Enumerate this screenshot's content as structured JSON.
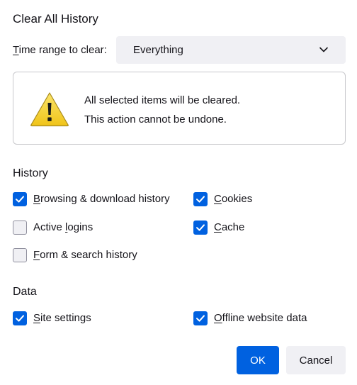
{
  "dialog": {
    "title": "Clear All History"
  },
  "time_range": {
    "label_first": "T",
    "label_rest": "ime range to clear:",
    "selected": "Everything",
    "chevron_icon": "chevron-down-icon"
  },
  "warning": {
    "icon": "warning-triangle-icon",
    "line1": "All selected items will be cleared.",
    "line2": "This action cannot be undone."
  },
  "history": {
    "heading": "History",
    "items": [
      {
        "u": "B",
        "rest": "rowsing & download history",
        "checked": true
      },
      {
        "u": "C",
        "rest": "ookies",
        "checked": true
      },
      {
        "pre": "Active ",
        "u": "l",
        "rest": "ogins",
        "checked": false
      },
      {
        "u": "C",
        "rest": "ache",
        "checked": true
      },
      {
        "u": "F",
        "rest": "orm & search history",
        "checked": false
      }
    ]
  },
  "data": {
    "heading": "Data",
    "items": [
      {
        "u": "S",
        "rest": "ite settings",
        "checked": true
      },
      {
        "u": "O",
        "rest": "ffline website data",
        "checked": true
      }
    ]
  },
  "buttons": {
    "ok": "OK",
    "cancel": "Cancel"
  },
  "colors": {
    "accent": "#0061e0",
    "button_secondary": "#f0f0f4",
    "text": "#15141a",
    "warning_yellow": "#f5d224"
  }
}
